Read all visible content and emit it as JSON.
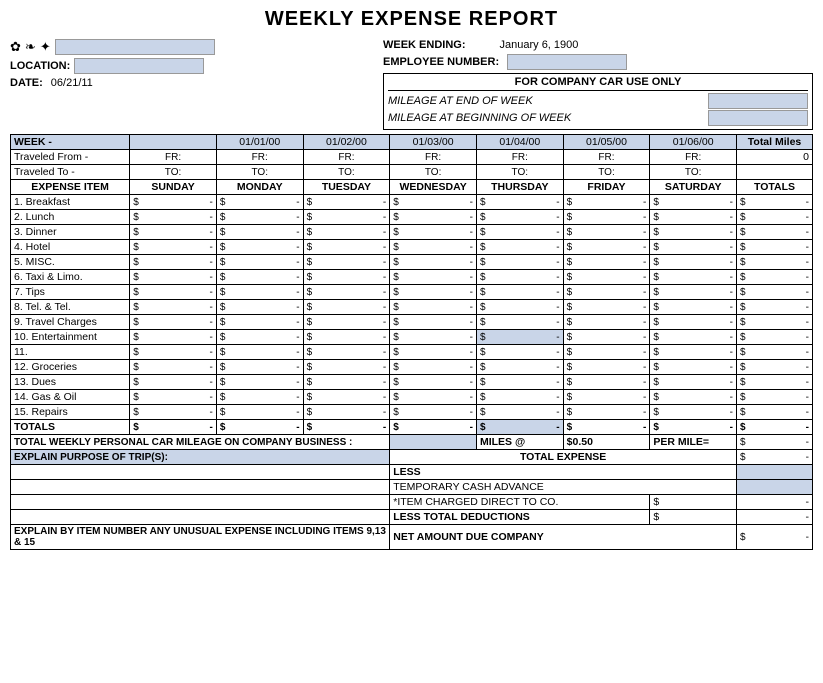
{
  "title": "WEEKLY EXPENSE REPORT",
  "header": {
    "week_ending_label": "WEEK ENDING:",
    "week_ending_value": "January 6, 1900",
    "employee_number_label": "EMPLOYEE NUMBER:",
    "location_label": "LOCATION:",
    "date_label": "DATE:",
    "date_value": "06/21/11",
    "icons": [
      "✿",
      "❧",
      "✦"
    ]
  },
  "company_car": {
    "title": "FOR COMPANY CAR USE ONLY",
    "mileage_end": "MILEAGE AT END OF WEEK",
    "mileage_begin": "MILEAGE AT BEGINNING OF WEEK"
  },
  "week_row": {
    "label": "WEEK -",
    "dates": [
      "01/01/00",
      "01/02/00",
      "01/03/00",
      "01/04/00",
      "01/05/00",
      "01/06/00"
    ],
    "total_miles_label": "Total Miles",
    "total_miles_value": "0"
  },
  "traveled_from": {
    "label": "Traveled From -",
    "days": [
      "FR:",
      "FR:",
      "FR:",
      "FR:",
      "FR:",
      "FR:",
      "FR:"
    ]
  },
  "traveled_to": {
    "label": "Traveled To -",
    "days": [
      "TO:",
      "TO:",
      "TO:",
      "TO:",
      "TO:",
      "TO:",
      "TO:"
    ]
  },
  "columns": {
    "item": "EXPENSE ITEM",
    "sunday": "SUNDAY",
    "monday": "MONDAY",
    "tuesday": "TUESDAY",
    "wednesday": "WEDNESDAY",
    "thursday": "THURSDAY",
    "friday": "FRIDAY",
    "saturday": "SATURDAY",
    "totals": "TOTALS"
  },
  "expense_items": [
    {
      "num": "1.",
      "name": "Breakfast"
    },
    {
      "num": "2.",
      "name": "Lunch"
    },
    {
      "num": "3.",
      "name": "Dinner"
    },
    {
      "num": "4.",
      "name": "Hotel"
    },
    {
      "num": "5.",
      "name": "MISC."
    },
    {
      "num": "6.",
      "name": "Taxi & Limo."
    },
    {
      "num": "7.",
      "name": "Tips"
    },
    {
      "num": "8.",
      "name": "Tel. & Tel."
    },
    {
      "num": "9.",
      "name": "Travel Charges"
    },
    {
      "num": "10.",
      "name": "Entertainment"
    },
    {
      "num": "11.",
      "name": ""
    },
    {
      "num": "12.",
      "name": "Groceries"
    },
    {
      "num": "13.",
      "name": "Dues"
    },
    {
      "num": "14.",
      "name": "Gas & Oil"
    },
    {
      "num": "15.",
      "name": "Repairs"
    }
  ],
  "totals_row_label": "TOTALS",
  "mileage": {
    "label": "TOTAL WEEKLY PERSONAL CAR MILEAGE ON COMPANY BUSINESS :",
    "miles_at": "MILES @",
    "rate": "$0.50",
    "per_mile": "PER MILE="
  },
  "purpose": {
    "label": "EXPLAIN PURPOSE OF TRIP(S):",
    "total_expense_label": "TOTAL EXPENSE"
  },
  "summary": {
    "less_label": "LESS",
    "temp_advance_label": "TEMPORARY CASH ADVANCE",
    "item_charged_label": "*ITEM CHARGED DIRECT TO CO.",
    "less_total_label": "LESS TOTAL DEDUCTIONS",
    "net_amount_label": "NET AMOUNT DUE COMPANY"
  },
  "explain_row": "EXPLAIN BY ITEM NUMBER ANY UNUSUAL EXPENSE INCLUDING ITEMS 9,13 & 15"
}
